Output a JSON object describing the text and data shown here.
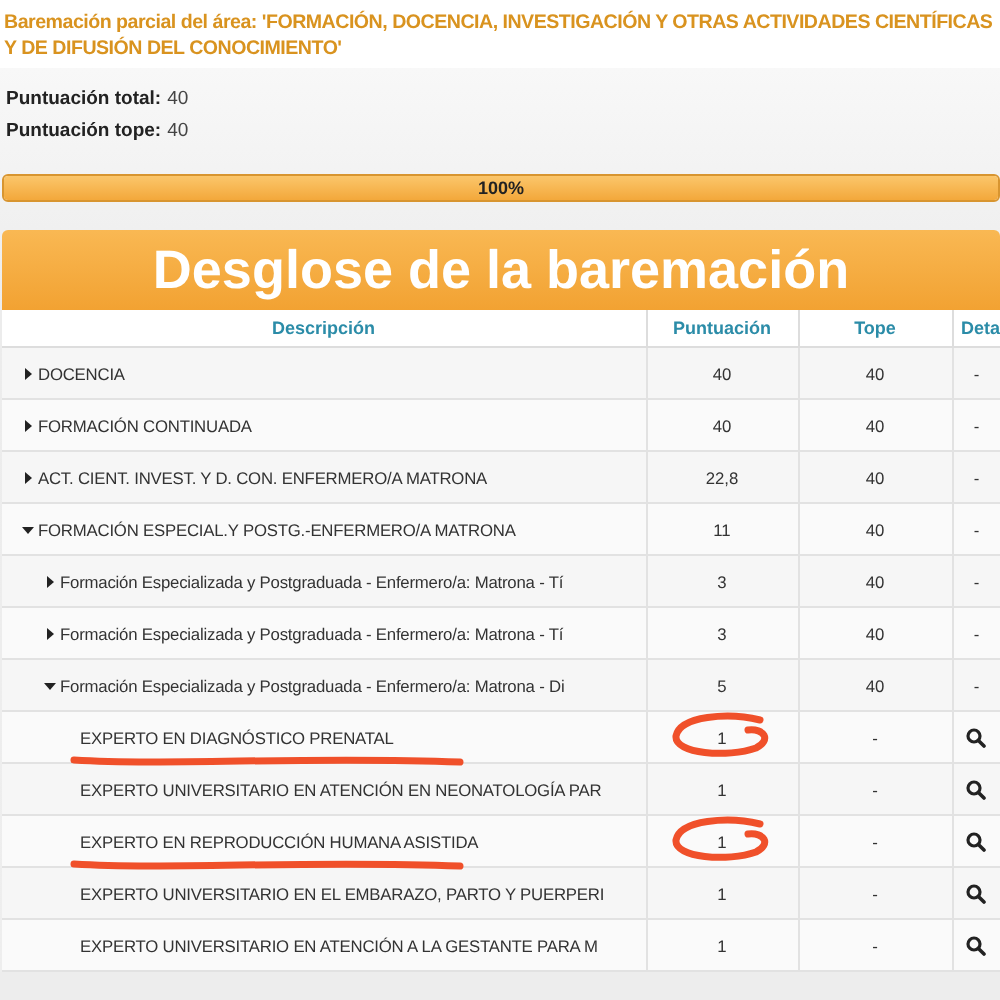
{
  "heading": "Baremación parcial del área: 'FORMACIÓN, DOCENCIA, INVESTIGACIÓN Y OTRAS ACTIVIDADES CIENTÍFICAS Y DE DIFUSIÓN DEL CONOCIMIENTO'",
  "scores": [
    {
      "label": "Puntuación total:",
      "value": "40"
    },
    {
      "label": "Puntuación tope:",
      "value": "40"
    }
  ],
  "progress": {
    "level": 1,
    "reading": "100%"
  },
  "panel_title": "Desglose de la baremación",
  "table": {
    "columns": [
      "Descripción",
      "Puntuación",
      "Tope",
      "Deta"
    ],
    "rows": [
      {
        "kind": "group",
        "description": "DOCENCIA",
        "expanded": false,
        "score": "40",
        "cap": "40",
        "detail": "-"
      },
      {
        "kind": "group",
        "description": "FORMACIÓN CONTINUADA",
        "expanded": false,
        "score": "40",
        "cap": "40",
        "detail": "-"
      },
      {
        "kind": "group",
        "description": "ACT. CIENT. INVEST. Y D. CON. ENFERMERO/A MATRONA",
        "expanded": false,
        "score": "22,8",
        "cap": "40",
        "detail": "-"
      },
      {
        "kind": "group",
        "description": "FORMACIÓN ESPECIAL.Y POSTG.-ENFERMERO/A MATRONA",
        "expanded": true,
        "score": "11",
        "cap": "40",
        "detail": "-",
        "children": [
          {
            "kind": "group",
            "description": "Formación Especializada y Postgraduada - Enfermero/a: Matrona - Tí",
            "expanded": false,
            "score": "3",
            "cap": "40",
            "detail": "-"
          },
          {
            "kind": "group",
            "description": "Formación Especializada y Postgraduada - Enfermero/a: Matrona - Tí",
            "expanded": false,
            "score": "3",
            "cap": "40",
            "detail": "-"
          },
          {
            "kind": "group",
            "description": "Formación Especializada y Postgraduada - Enfermero/a: Matrona - Di",
            "expanded": true,
            "score": "5",
            "cap": "40",
            "detail": "-",
            "children": [
              {
                "kind": "item",
                "description": "EXPERTO EN DIAGNÓSTICO PRENATAL",
                "score": "1",
                "cap": "-",
                "hand_marked": true
              },
              {
                "kind": "item",
                "description": "EXPERTO UNIVERSITARIO EN ATENCIÓN EN NEONATOLOGÍA PAR",
                "score": "1",
                "cap": "-",
                "hand_marked": false
              },
              {
                "kind": "item",
                "description": "EXPERTO EN REPRODUCCIÓN HUMANA ASISTIDA",
                "score": "1",
                "cap": "-",
                "hand_marked": true
              },
              {
                "kind": "item",
                "description": "EXPERTO UNIVERSITARIO EN EL EMBARAZO, PARTO Y PUERPERI",
                "score": "1",
                "cap": "-",
                "hand_marked": false
              },
              {
                "kind": "item",
                "description": "EXPERTO UNIVERSITARIO EN ATENCIÓN A LA GESTANTE PARA M",
                "score": "1",
                "cap": "-",
                "hand_marked": false
              }
            ]
          }
        ]
      }
    ]
  }
}
